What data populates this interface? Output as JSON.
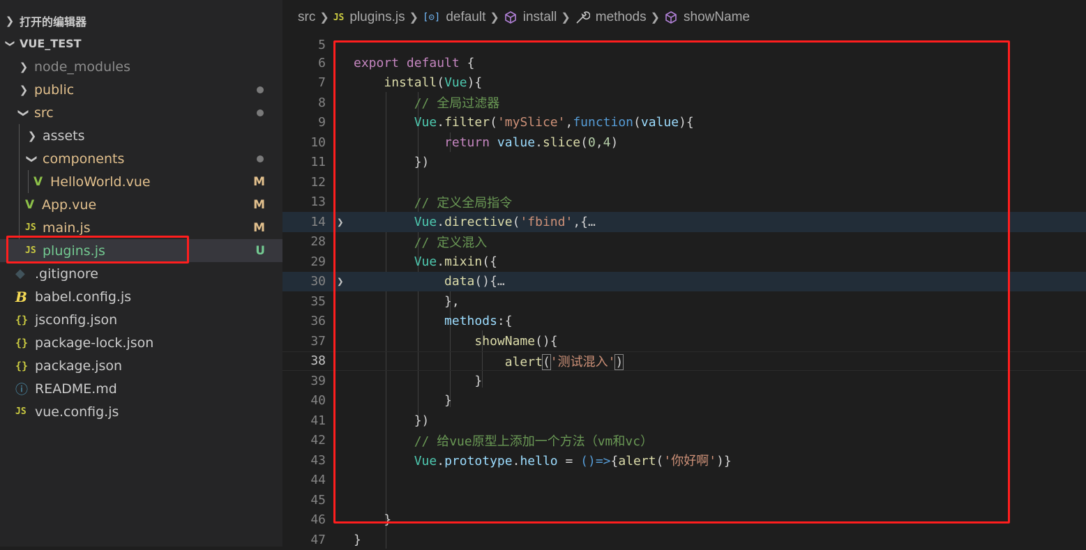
{
  "sidebar": {
    "open_editors_label": "打开的编辑器",
    "project_label": "VUE_TEST",
    "items": [
      {
        "label": "node_modules",
        "type": "folder",
        "status": ""
      },
      {
        "label": "public",
        "type": "folder",
        "status": "dot"
      },
      {
        "label": "src",
        "type": "folder-open",
        "status": "dot"
      },
      {
        "label": "assets",
        "type": "folder",
        "status": ""
      },
      {
        "label": "components",
        "type": "folder-open",
        "status": "dot"
      },
      {
        "label": "HelloWorld.vue",
        "type": "vue",
        "status": "M"
      },
      {
        "label": "App.vue",
        "type": "vue",
        "status": "M"
      },
      {
        "label": "main.js",
        "type": "js",
        "status": "M"
      },
      {
        "label": "plugins.js",
        "type": "js",
        "status": "U"
      },
      {
        "label": ".gitignore",
        "type": "git",
        "status": ""
      },
      {
        "label": "babel.config.js",
        "type": "babel",
        "status": ""
      },
      {
        "label": "jsconfig.json",
        "type": "json",
        "status": ""
      },
      {
        "label": "package-lock.json",
        "type": "json",
        "status": ""
      },
      {
        "label": "package.json",
        "type": "json",
        "status": ""
      },
      {
        "label": "README.md",
        "type": "info",
        "status": ""
      },
      {
        "label": "vue.config.js",
        "type": "js",
        "status": ""
      }
    ],
    "icons": {
      "js": "JS",
      "json": "{}",
      "vue": "V",
      "babel": "B",
      "info": "ⓘ",
      "git": "◆"
    }
  },
  "breadcrumb": {
    "items": [
      "src",
      "plugins.js",
      "default",
      "install",
      "methods",
      "showName"
    ]
  },
  "editor": {
    "line_numbers": [
      "5",
      "6",
      "7",
      "8",
      "9",
      "10",
      "11",
      "12",
      "13",
      "14",
      "28",
      "29",
      "30",
      "35",
      "36",
      "37",
      "38",
      "39",
      "40",
      "41",
      "42",
      "43",
      "44",
      "45",
      "46",
      "47"
    ],
    "tokens": {
      "export": "export",
      "default": "default",
      "brace_open": " {",
      "install": "install",
      "vue_param": "Vue",
      "paren_close_brace": "){",
      "cmt_global_filter": "// 全局过滤器",
      "Vue": "Vue",
      "dot": ".",
      "filter": "filter",
      "str_myslice": "'mySlice'",
      "comma": ",",
      "function": "function",
      "value": "value",
      "paren_brace": "){",
      "return": "return",
      "slice": "slice",
      "num_0": "0",
      "num_4": "4",
      "close_paren": ")",
      "close_brace_paren": "})",
      "cmt_directive": "// 定义全局指令",
      "directive": "directive",
      "str_fbind": "'fbind'",
      "fold_brace": ",{",
      "ellipsis": "…",
      "cmt_mixin": "// 定义混入",
      "mixin": "mixin",
      "paren_obj": "({",
      "data": "data",
      "empty_paren_brace": "(){",
      "close_brace_comma": "},",
      "methods": "methods",
      "colon_brace": ":{",
      "showName": "showName",
      "alert": "alert",
      "str_test_mixin": "'测试混入'",
      "close_brace": "}",
      "cmt_prototype": "// 给vue原型上添加一个方法（vm和vc）",
      "prototype": "prototype",
      "hello": "hello",
      "eq": " = ",
      "arrow": "()=>",
      "str_nihao": "'你好啊'",
      "close_paren_brace": ")}"
    }
  }
}
